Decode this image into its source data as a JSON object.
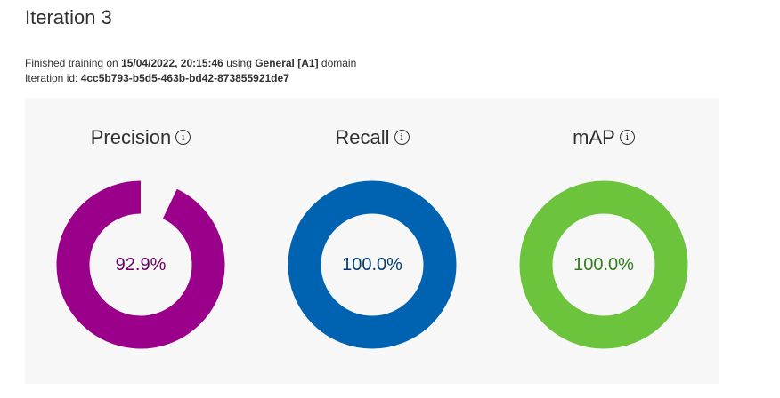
{
  "page": {
    "title": "Iteration 3",
    "training": {
      "prefix": "Finished training on ",
      "datetime": "15/04/2022, 20:15:46",
      "middle": " using ",
      "domain_name": "General [A1]",
      "suffix": " domain"
    },
    "iteration_id": {
      "label": "Iteration id: ",
      "value": "4cc5b793-b5d5-463b-bd42-873855921de7"
    }
  },
  "info_icon_glyph": "i",
  "metrics": [
    {
      "name": "Precision",
      "display": "92.9%",
      "percent": 92.9,
      "color": "#9a0089",
      "text_color": "#6b0061"
    },
    {
      "name": "Recall",
      "display": "100.0%",
      "percent": 100.0,
      "color": "#0063b1",
      "text_color": "#003b75"
    },
    {
      "name": "mAP",
      "display": "100.0%",
      "percent": 100.0,
      "color": "#6bc43c",
      "text_color": "#2f7d1a"
    }
  ]
}
